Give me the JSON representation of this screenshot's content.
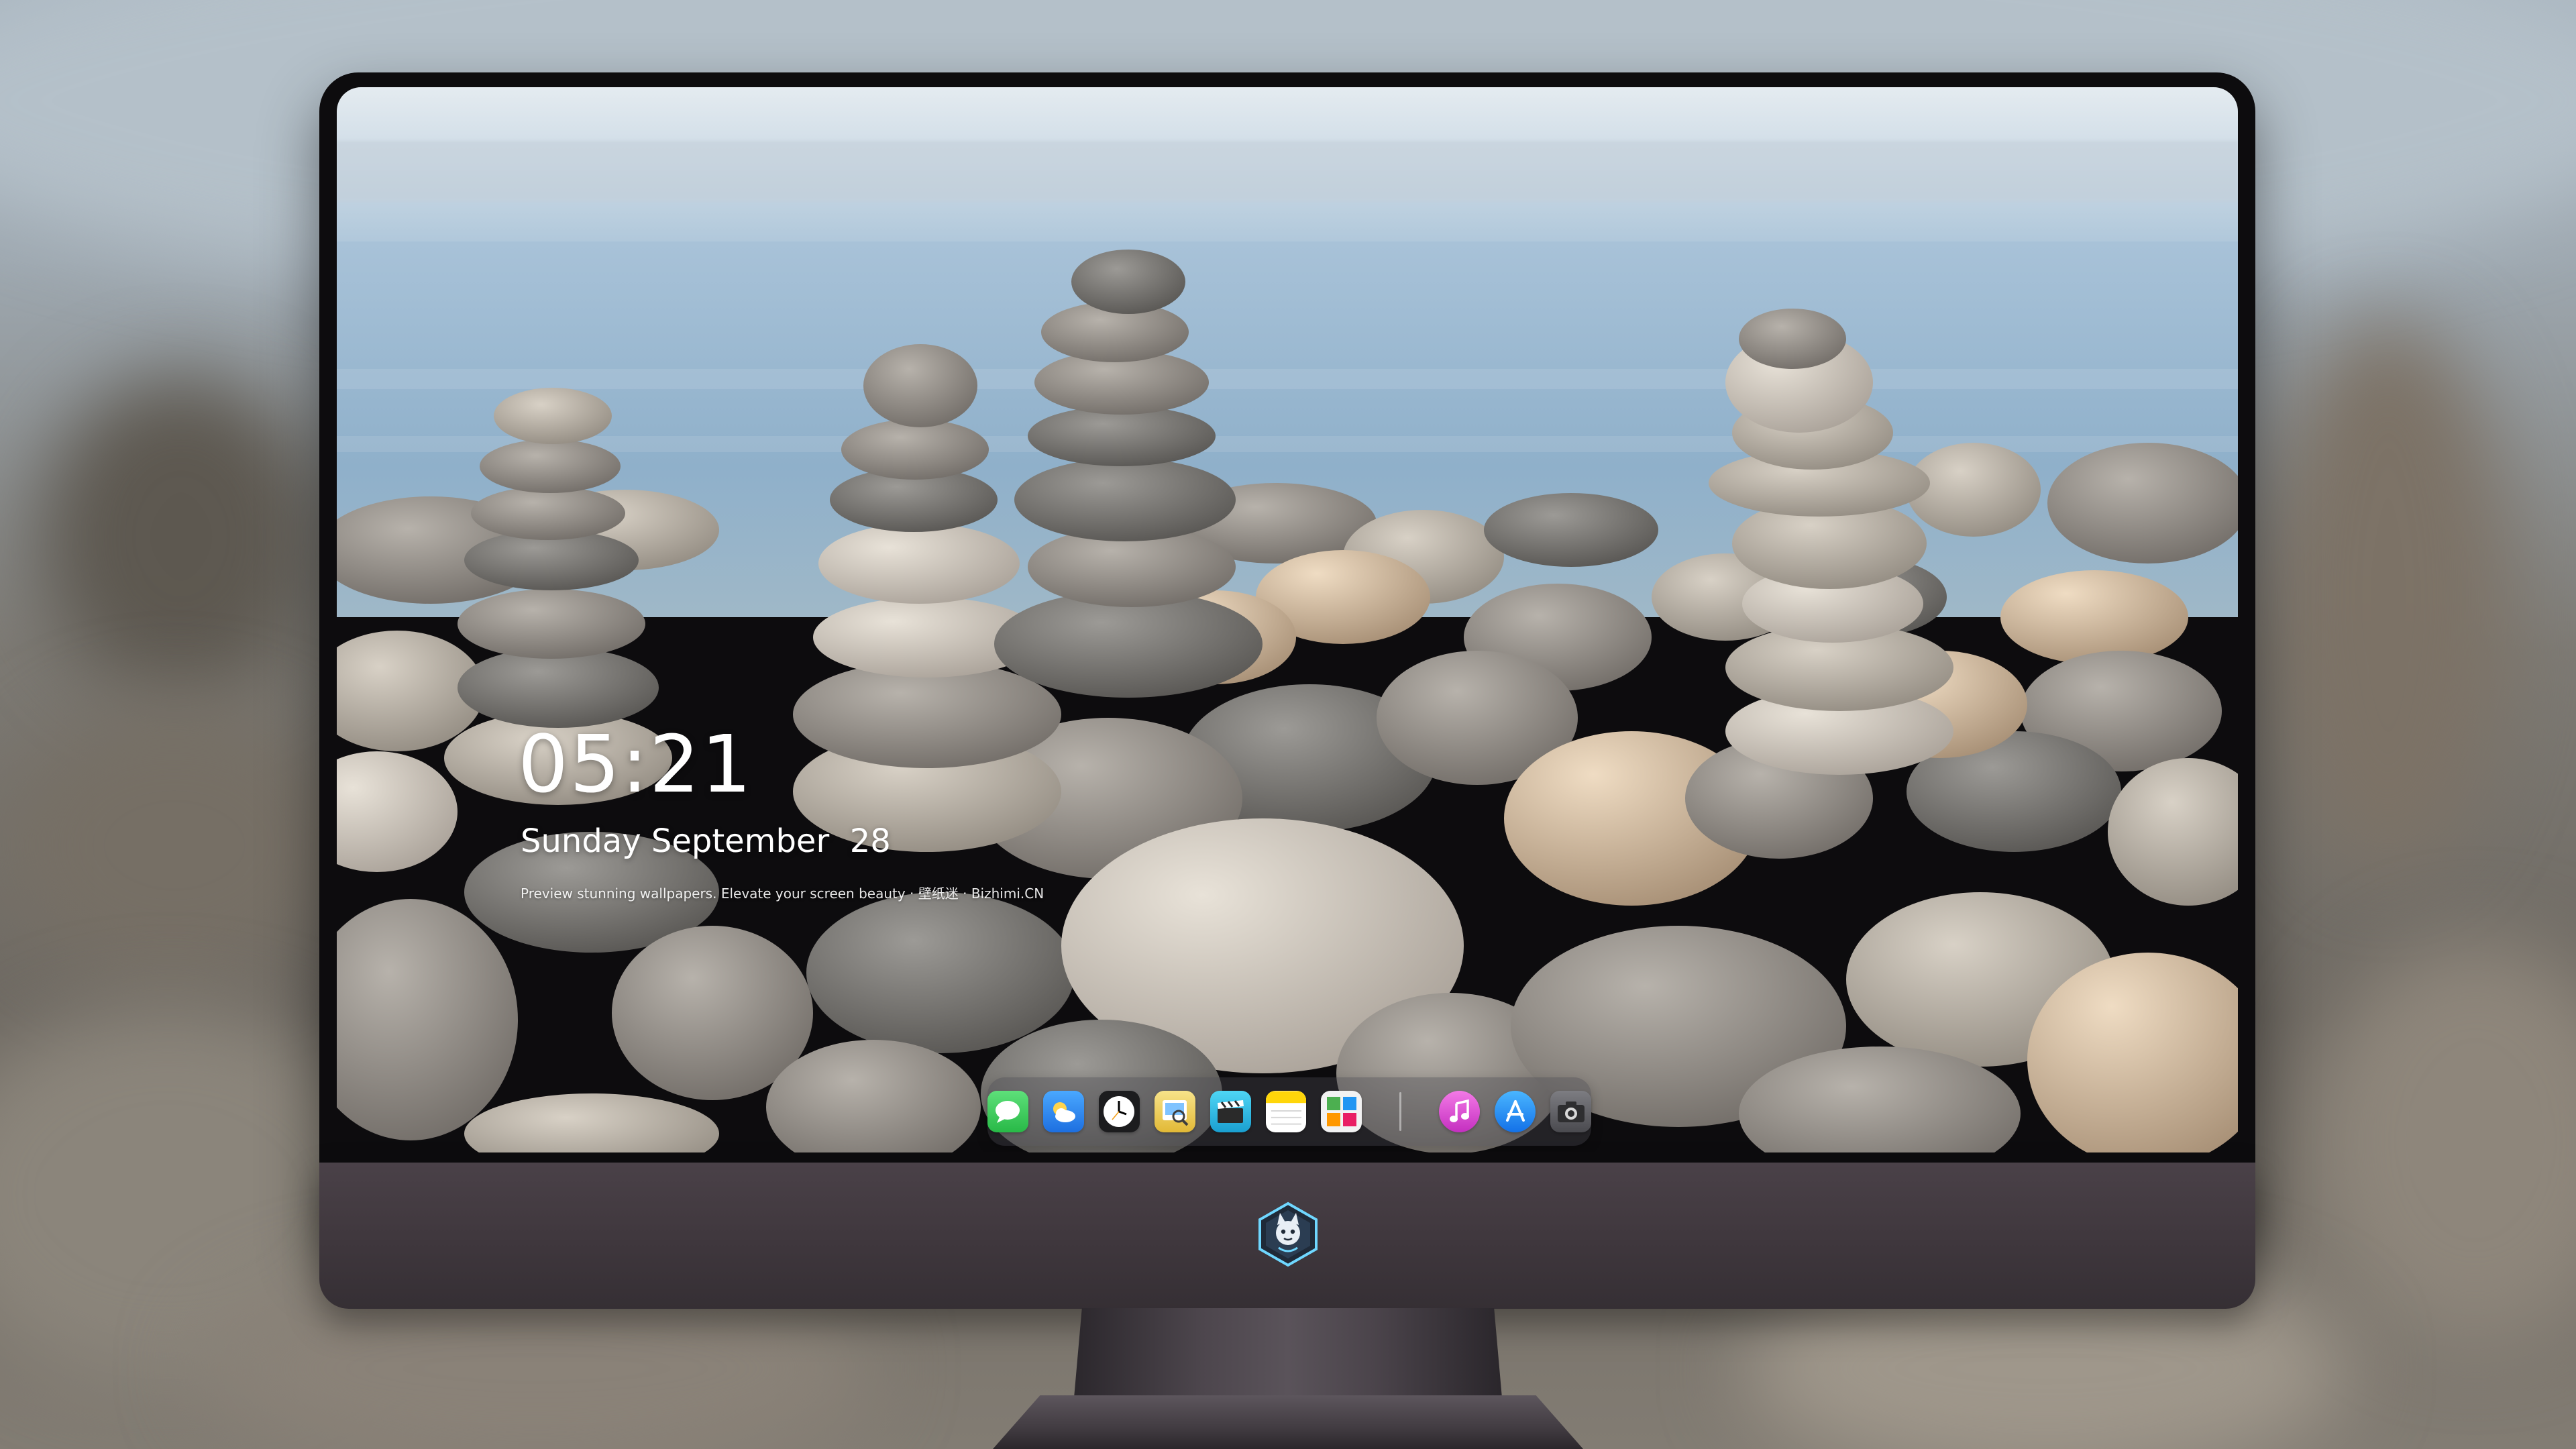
{
  "lock_screen": {
    "time": "05:21",
    "date": "Sunday September  28",
    "caption": "Preview stunning wallpapers. Elevate your screen beauty · 壁纸迷 · Bizhimi.CN"
  },
  "dock": {
    "apps": [
      {
        "name": "Messages",
        "icon": "messages-icon",
        "color": "#34c759"
      },
      {
        "name": "Weather",
        "icon": "weather-icon",
        "color": "#2f8cf0"
      },
      {
        "name": "Clock",
        "icon": "clock-icon",
        "color": "#1c1c1e"
      },
      {
        "name": "Preview",
        "icon": "preview-icon",
        "color": "#f2c94c"
      },
      {
        "name": "Clips",
        "icon": "clapperboard-icon",
        "color": "#2ac1e6"
      },
      {
        "name": "Notes",
        "icon": "notes-icon",
        "color": "#ffd60a"
      },
      {
        "name": "Photo Booth",
        "icon": "photo-grid-icon",
        "color": "#4caf50"
      },
      {
        "name": "Music",
        "icon": "music-note-icon",
        "color": "#e53fd0"
      },
      {
        "name": "App Store",
        "icon": "app-store-icon",
        "color": "#1a8cff"
      },
      {
        "name": "Camera",
        "icon": "camera-icon",
        "color": "#5b5b60"
      }
    ]
  },
  "colors": {
    "monitor_bezel": "#0d0c0e",
    "monitor_chin": "#3f373d",
    "text_primary": "#ffffff"
  }
}
